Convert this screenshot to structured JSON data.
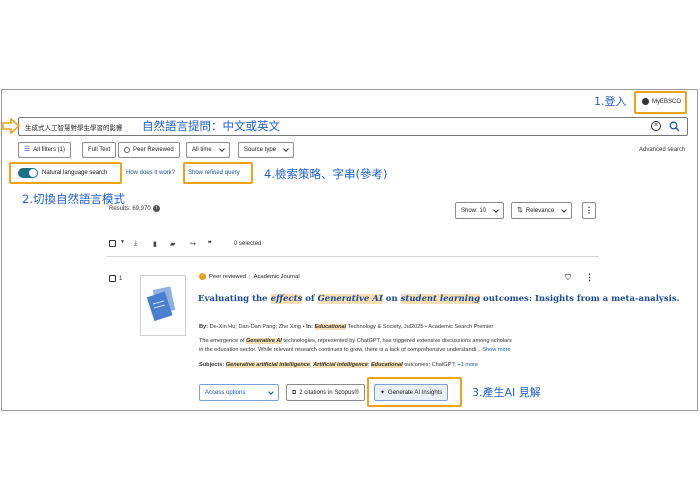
{
  "header": {
    "login_annotation": "1.登入",
    "myebsco_label": "MyEBSCO"
  },
  "search": {
    "query": "生成式人工智慧對學生學習的影響",
    "annotation": "自然語言提問：中文或英文",
    "advanced_label": "Advanced search"
  },
  "filters": {
    "all_filters": "All filters (1)",
    "full_text": "Full Text",
    "peer_reviewed": "Peer Reviewed",
    "all_time": "All time",
    "source_type": "Source type"
  },
  "nl_search": {
    "label": "Natural language search",
    "how_link": "How does it work?",
    "refined_query": "Show refined query",
    "toggle_annotation": "2.切換自然語言模式",
    "strategy_annotation": "4.檢索策略、字串(參考)"
  },
  "results": {
    "count_label": "Results: 69,970",
    "show_label": "Show: 10",
    "sort_label": "Relevance",
    "selected_label": "0 selected"
  },
  "record": {
    "index": "1",
    "peer_reviewed": "Peer reviewed",
    "source_kind": "Academic Journal",
    "title_parts": [
      "Evaluating the ",
      "effects",
      " of ",
      "Generative AI",
      " on ",
      "student learning",
      " outcomes: Insights from a meta-analysis."
    ],
    "by_label": "By:",
    "authors": "De-Xin Hu; Dan-Dan Pang; Zhe Xing",
    "in_label": "In:",
    "journal_hl": "Educational",
    "journal_rest": "Technology & Society, Jul2025",
    "database": "Academic Search Premier",
    "abstract_1_pre": "The emergence of ",
    "abstract_1_hl": "Generative AI",
    "abstract_1_post": " technologies, represented by ChatGPT, has triggered extensive discussions among scholars",
    "abstract_2": "in the education sector. While relevant research continues to grow, there is a lack of comprehensive understandi...",
    "show_more": "Show more",
    "subjects_label": "Subjects:",
    "subject_1": "Generative artificial intelligence",
    "subject_2": "Artificial intelligence",
    "subject_3": "Educational",
    "subject_3_rest": "outcomes; ChatGPT;",
    "more_subjects": "+1 more",
    "access_options": "Access options",
    "citations": "2 citations in Scopus®",
    "generate_ai": "Generate AI Insights",
    "ai_annotation": "3.產生AI 見解"
  },
  "colors": {
    "annotation_blue": "#1f5fcf",
    "highlight_orange": "#f0a21a",
    "toggle_teal": "#1b6f86",
    "link_blue": "#1a56a8"
  }
}
